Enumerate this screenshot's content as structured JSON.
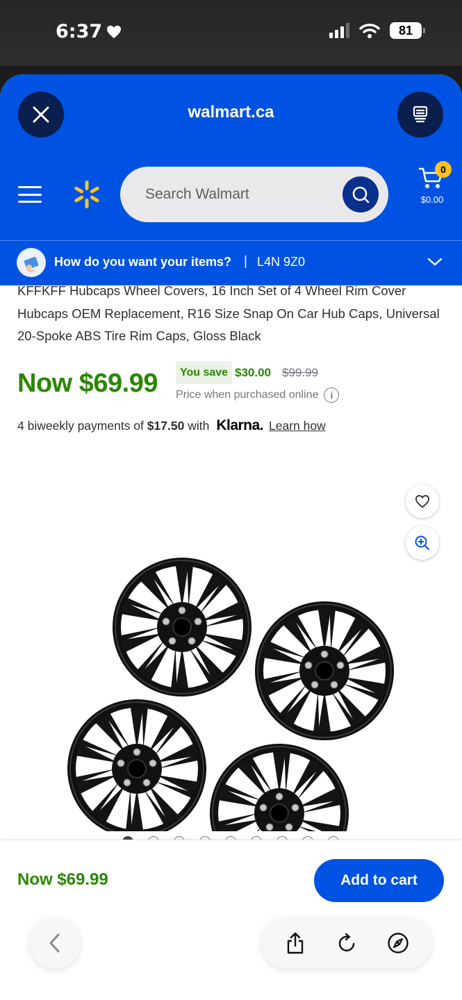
{
  "status_bar": {
    "time": "6:37",
    "battery": "81"
  },
  "browser": {
    "domain": "walmart.ca",
    "close_icon": "close-icon",
    "tabs_icon": "tabs-icon"
  },
  "header": {
    "search_placeholder": "Search Walmart",
    "cart_count": "0",
    "cart_total": "$0.00",
    "brand_color": "#0053e2",
    "spark_color": "#ffc220"
  },
  "delivery": {
    "question": "How do you want your items?",
    "separator": "|",
    "postal_code": "L4N 9Z0"
  },
  "product": {
    "title": "KFFKFF Hubcaps Wheel Covers, 16 Inch Set of 4 Wheel Rim Cover Hubcaps OEM Replacement, R16 Size Snap On Car Hub Caps, Universal 20-Spoke ABS Tire Rim Caps, Gloss Black",
    "price_now": "Now $69.99",
    "you_save_label": "You save",
    "save_amount": "$30.00",
    "was_price": "$99.99",
    "online_note": "Price when purchased online",
    "info_glyph": "i",
    "price_color": "#2a8703"
  },
  "klarna": {
    "prefix": "4 biweekly payments of",
    "amount": "$17.50",
    "with": "with",
    "brand": "Klarna.",
    "learn": "Learn how"
  },
  "gallery": {
    "dot_count": 9,
    "active_dot": 1
  },
  "bottom": {
    "price": "Now $69.99",
    "add_to_cart": "Add to cart"
  }
}
